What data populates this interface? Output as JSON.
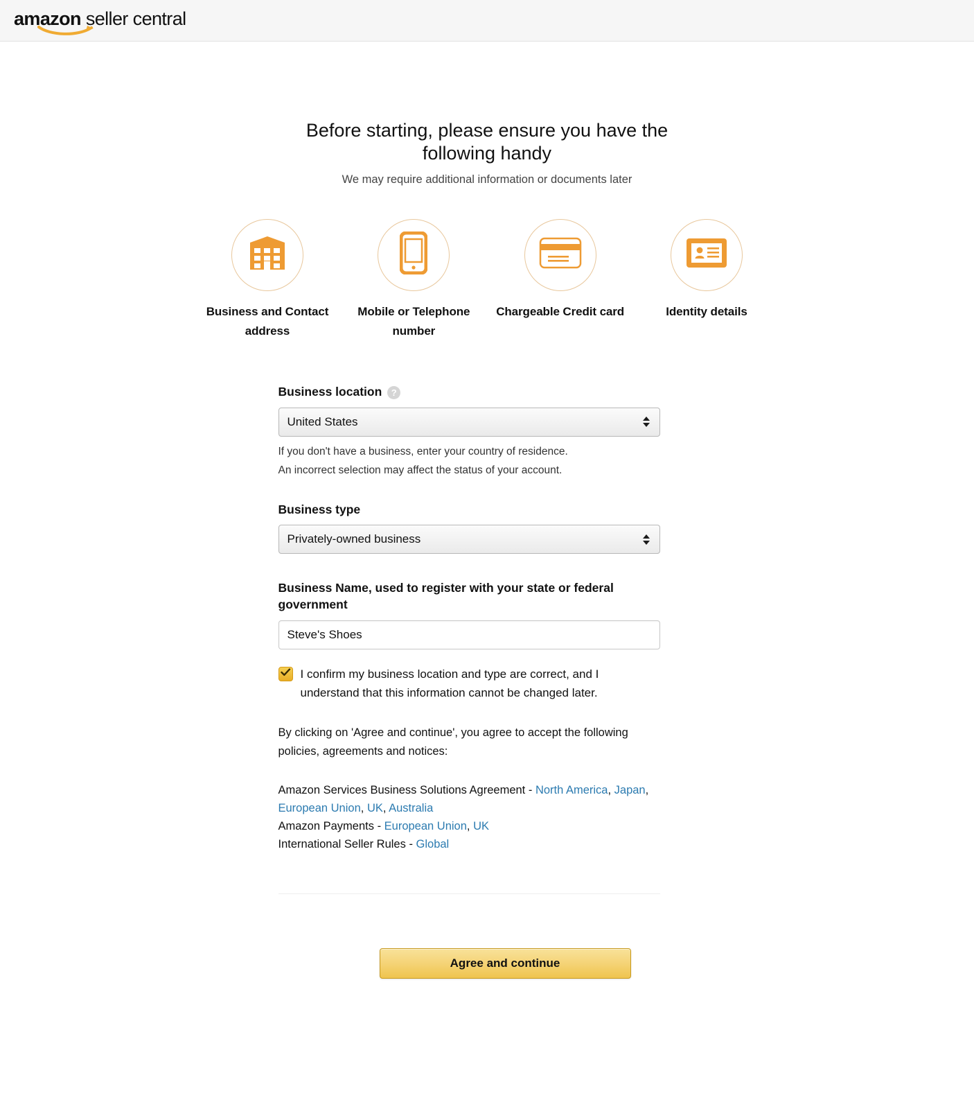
{
  "header": {
    "logo_brand": "amazon",
    "logo_product": "seller central",
    "logo_icon": "amazon-smile-icon"
  },
  "hero": {
    "title": "Before starting, please ensure you have the following handy",
    "subtitle": "We may require additional information or documents later"
  },
  "requirements": [
    {
      "icon": "building-icon",
      "label": "Business and Contact address"
    },
    {
      "icon": "mobile-phone-icon",
      "label": "Mobile or Telephone number"
    },
    {
      "icon": "credit-card-icon",
      "label": "Chargeable Credit card"
    },
    {
      "icon": "id-card-icon",
      "label": "Identity details"
    }
  ],
  "form": {
    "business_location": {
      "label": "Business location",
      "help_icon": "question-mark-icon",
      "value": "United States",
      "options": [
        "United States"
      ],
      "hint_line_1": "If you don't have a business, enter your country of residence.",
      "hint_line_2": "An incorrect selection may affect the status of your account."
    },
    "business_type": {
      "label": "Business type",
      "value": "Privately-owned business",
      "options": [
        "Privately-owned business"
      ]
    },
    "business_name": {
      "label": "Business Name, used to register with your state or federal government",
      "value": "Steve's Shoes",
      "placeholder": ""
    },
    "confirm": {
      "checked": true,
      "check_icon": "checkmark-icon",
      "text": "I confirm my business location and type are correct, and I understand that this information cannot be changed later."
    }
  },
  "agreement": {
    "intro": "By clicking on 'Agree and continue', you agree to accept the following policies, agreements and notices:",
    "policies": [
      {
        "name": "Amazon Services Business Solutions Agreement",
        "separator": " - ",
        "links": [
          "North America",
          "Japan",
          "European Union",
          "UK",
          "Australia"
        ]
      },
      {
        "name": "Amazon Payments",
        "separator": " - ",
        "links": [
          "European Union",
          "UK"
        ]
      },
      {
        "name": "International Seller Rules",
        "separator": " - ",
        "links": [
          "Global"
        ]
      }
    ]
  },
  "footer": {
    "submit_label": "Agree and continue"
  },
  "colors": {
    "accent_orange": "#ee9b33",
    "button_gold": "#f5d478",
    "link_blue": "#2c7bb0",
    "header_bg": "#f6f6f6"
  }
}
